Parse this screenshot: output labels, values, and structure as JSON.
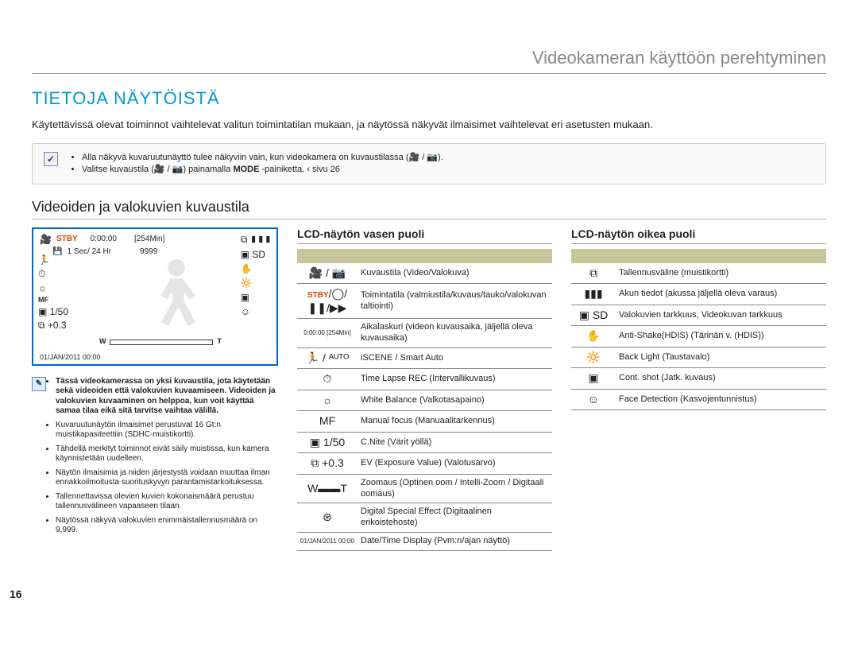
{
  "header": {
    "section": "Videokameran käyttöön perehtyminen"
  },
  "title": "TIETOJA NÄYTÖISTÄ",
  "intro": "Käytettävissä olevat toiminnot vaihtelevat valitun toimintatilan mukaan, ja näytössä näkyvät ilmaisimet vaihtelevat eri asetusten mukaan.",
  "infobox": {
    "b1": "Alla näkyvä kuvaruutunäyttö tulee näkyviin vain, kun videokamera on kuvaustilassa (🎥 / 📷).",
    "b2_a": "Valitse kuvaustila (🎥 / 📷) painamalla ",
    "b2_mode": "MODE",
    "b2_b": " -painiketta. ‹ sivu 26"
  },
  "subsec": "Videoiden ja valokuvien kuvaustila",
  "lcd": {
    "stby": "STBY",
    "time": "0:00:00",
    "remain": "[254Min]",
    "sec_hr": "1 Sec/ 24 Hr",
    "count": "9999",
    "shutter": "1/50",
    "ev": "+0.3",
    "date": "01/JAN/2011 00:00",
    "sd": "SD"
  },
  "notes": {
    "items": [
      "Tässä videokamerassa on yksi kuvaustila, jota käytetään sekä videoiden että valokuvien kuvaamiseen. Videoiden ja valokuvien kuvaaminen on helppoa, kun voit käyttää samaa tilaa eikä sitä tarvitse vaihtaa välillä.",
      "Kuvaruutunäytön ilmaisimet perustuvat 16 Gt:n muistikapasiteettiin (SDHC-muistikortti).",
      "Tähdellä  merkityt toiminnot eivät säily muistissa, kun kamera käynnistetään uudelleen.",
      "Näytön ilmaisimia ja niiden järjestystä voidaan muuttaa ilman ennakkoilmoitusta suorituskyvyn parantamistarkoituksessa.",
      "Tallennettavissa olevien kuvien kokonaismäärä perustuu tallennusvälineen vapaaseen tilaan.",
      "Näytössä näkyvä valokuvien enimmäistallennusmäärä on 9,999."
    ]
  },
  "left_table": {
    "heading": "LCD-näytön vasen puoli",
    "rows": [
      {
        "icon": "🎥 / 📷",
        "desc": "Kuvaustila (Video/Valokuva)"
      },
      {
        "icon": "STBY/◯/❚❚/▶▶",
        "stby_style": true,
        "desc": "Toimintatila (valmiustila/kuvaus/tauko/valokuvan taltiointi)"
      },
      {
        "icon": "0:00:00 [254Min]",
        "small": true,
        "desc": "Aikalaskuri (videon kuvausaika, jäljellä oleva kuvausaika)"
      },
      {
        "icon": "🏃 / ᴬᵁᵀᴼ",
        "desc": "iSCENE  / Smart Auto"
      },
      {
        "icon": "⏱",
        "desc": "Time Lapse REC (Intervallikuvaus)"
      },
      {
        "icon": "☼",
        "desc": "White Balance (Valkotasapaino)"
      },
      {
        "icon": "MF",
        "desc": "Manual focus (Manuaalitarkennus)"
      },
      {
        "icon": "▣ 1/50",
        "desc": "C.Nite (Värit yöllä)"
      },
      {
        "icon": "⧉ +0.3",
        "desc": "EV (Exposure Value) (Valotusarvo)"
      },
      {
        "icon": "W▬▬T",
        "desc": "Zoomaus (Optinen  oom / Intelli-Zoom / Digitaali oomaus)"
      },
      {
        "icon": "⊛",
        "desc": "Digital Special Effect (Digitaalinen erikoistehoste)"
      },
      {
        "icon": "01/JAN/2011 00:00",
        "small": true,
        "desc": "Date/Time Display (Pvm:n/ajan näyttö)"
      }
    ]
  },
  "right_table": {
    "heading": "LCD-näytön oikea puoli",
    "rows": [
      {
        "icon": "⧉",
        "desc": "Tallennusväline (muistikortti)"
      },
      {
        "icon": "▮▮▮",
        "desc": "Akun tiedot (akussa jäljellä oleva varaus)"
      },
      {
        "icon": "▣ SD",
        "desc": "Valokuvien tarkkuus, Videokuvan tarkkuus"
      },
      {
        "icon": "✋",
        "desc": "Anti-Shake(HDIS) (Tärinän v. (HDIS))"
      },
      {
        "icon": "🔆",
        "desc": "Back Light (Taustavalo)"
      },
      {
        "icon": "▣",
        "desc": "Cont. shot (Jatk. kuvaus)"
      },
      {
        "icon": "☺",
        "desc": "Face Detection (Kasvojentunnistus)"
      }
    ]
  },
  "page_number": "16"
}
